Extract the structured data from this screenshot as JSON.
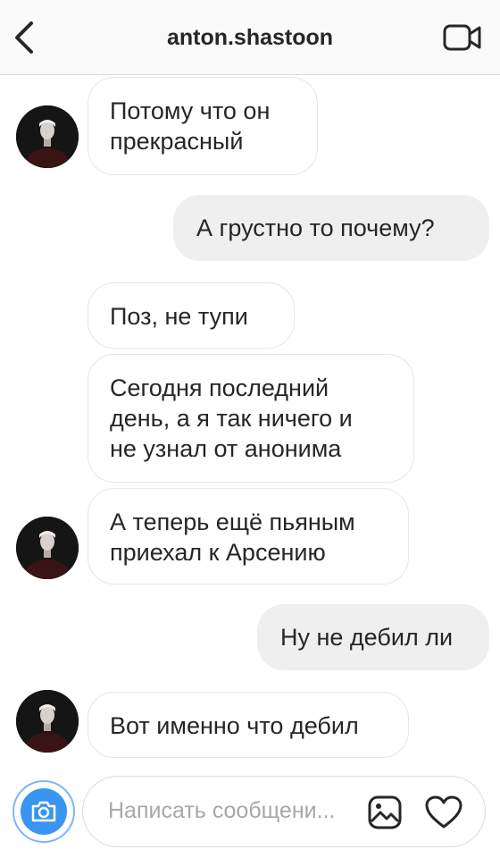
{
  "header": {
    "title": "anton.shastoon",
    "back_icon": "chevron-left-icon",
    "video_icon": "video-camera-icon"
  },
  "messages": [
    {
      "side": "in",
      "text": "Потому что он\nпрекрасный"
    },
    {
      "side": "out",
      "text": "А грустно то почему?"
    },
    {
      "side": "in",
      "text": "Поз, не тупи"
    },
    {
      "side": "in",
      "text": "Сегодня последний\nдень, а я так ничего и\nне узнал от анонима"
    },
    {
      "side": "in",
      "text": "А теперь ещё пьяным\nприехал к Арсению"
    },
    {
      "side": "out",
      "text": "Ну не дебил ли"
    },
    {
      "side": "in",
      "text": "Вот именно что дебил"
    }
  ],
  "composer": {
    "placeholder": "Написать сообщени...",
    "camera_icon": "camera-icon",
    "gallery_icon": "gallery-icon",
    "heart_icon": "heart-icon"
  },
  "colors": {
    "incoming_bg": "#ffffff",
    "outgoing_bg": "#efefef",
    "camera_blue": "#3a94f1"
  }
}
